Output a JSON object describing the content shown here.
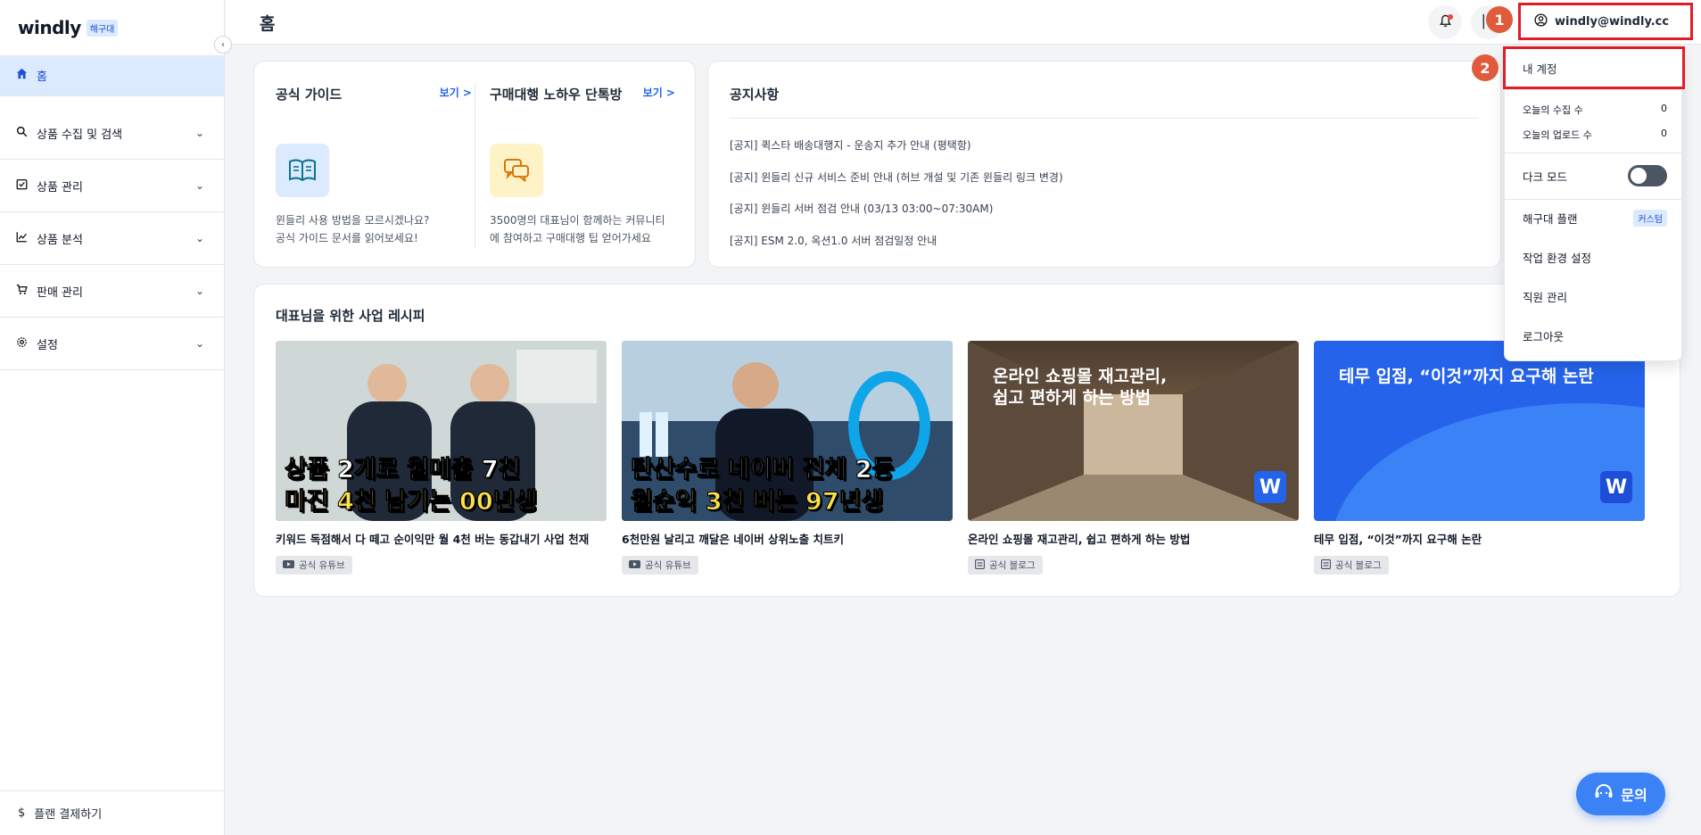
{
  "sidebar": {
    "logo": "windly",
    "logo_badge": "해구대",
    "home": "홈",
    "items": [
      {
        "label": "상품 수집 및 검색",
        "icon": "search-icon"
      },
      {
        "label": "상품 관리",
        "icon": "checklist-icon"
      },
      {
        "label": "상품 분석",
        "icon": "chart-icon"
      },
      {
        "label": "판매 관리",
        "icon": "cart-icon"
      },
      {
        "label": "설정",
        "icon": "gear-icon"
      }
    ],
    "footer": "플랜 결제하기"
  },
  "header": {
    "title": "홈",
    "account_email": "windly@windly.cc"
  },
  "guide": {
    "official_title": "공식 가이드",
    "official_link": "보기 >",
    "official_desc1": "윈들리 사용 방법을 모르시겠나요?",
    "official_desc2": "공식 가이드 문서를 읽어보세요!",
    "community_title": "구매대행 노하우 단톡방",
    "community_link": "보기 >",
    "community_desc1": "3500명의 대표님이 함께하는 커뮤니티",
    "community_desc2": "에 참여하고 구매대행 팁 얻어가세요"
  },
  "notice": {
    "title": "공지사항",
    "items": [
      "[공지] 퀵스타 배송대행지 - 운송지 추가 안내 (평택항)",
      "[공지] 윈들리 신규 서비스 준비 안내 (허브 개설 및 기존 윈들리 링크 변경)",
      "[공지] 윈들리 서버 점검 안내 (03/13 03:00~07:30AM)",
      "[공지] ESM 2.0, 옥션1.0 서버 점검일정 안내"
    ]
  },
  "recipe": {
    "title": "대표님을 위한 사업 레시피",
    "cards": [
      {
        "cap1": "상품 2개로 월매출 7천",
        "cap2": "마진 4천 남기는 00년생",
        "title": "키워드 독점해서 다 떼고 순이익만 월 4천 버는 동갑내기 사업 천재",
        "tag": "공식 유튜브"
      },
      {
        "cap1": "탄산수로 네이버 전체 2등",
        "cap2": "월순익 3천 버는 97년생",
        "title": "6천만원 날리고 깨달은 네이버 상위노출 치트키",
        "tag": "공식 유튜브"
      },
      {
        "text1": "온라인 쇼핑몰 재고관리,",
        "text2": "쉽고 편하게 하는 방법",
        "title": "온라인 쇼핑몰 재고관리, 쉽고 편하게 하는 방법",
        "tag": "공식 블로그",
        "logo": "W"
      },
      {
        "text1": "테무 입점, “이것”까지 요구해 논란",
        "title": "테무 입점, “이것”까지 요구해 논란",
        "tag": "공식 블로그",
        "logo": "W"
      }
    ]
  },
  "dropdown": {
    "my_account": "내 계정",
    "collect_label": "오늘의 수집 수",
    "collect_value": "0",
    "upload_label": "오늘의 업로드 수",
    "upload_value": "0",
    "dark_mode": "다크 모드",
    "plan_label": "해구대 플랜",
    "plan_badge": "커스텀",
    "workspace": "작업 환경 설정",
    "staff": "직원 관리",
    "logout": "로그아웃"
  },
  "steps": [
    "1",
    "2"
  ],
  "chat": {
    "label": "문의"
  },
  "colors": {
    "accent": "#2563eb",
    "highlight": "#e11d2a",
    "step": "#e05b3c"
  }
}
